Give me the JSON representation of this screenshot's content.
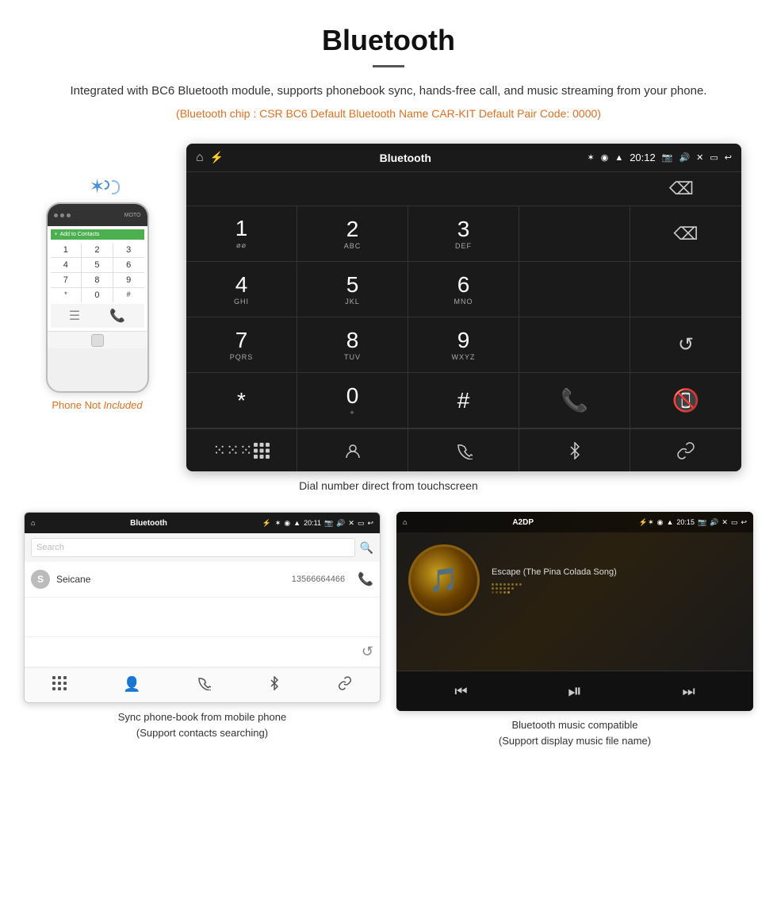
{
  "header": {
    "title": "Bluetooth",
    "description": "Integrated with BC6 Bluetooth module, supports phonebook sync, hands-free call, and music streaming from your phone.",
    "specs": "(Bluetooth chip : CSR BC6    Default Bluetooth Name CAR-KIT    Default Pair Code: 0000)"
  },
  "phone_label": {
    "not": "Phone Not",
    "included": " Included"
  },
  "dial_screen": {
    "status_bar": {
      "title": "Bluetooth",
      "time": "20:12"
    },
    "keys": [
      {
        "num": "1",
        "sub": "∽∽"
      },
      {
        "num": "2",
        "sub": "ABC"
      },
      {
        "num": "3",
        "sub": "DEF"
      },
      {
        "num": "",
        "sub": ""
      },
      {
        "num": "⌫",
        "sub": ""
      },
      {
        "num": "4",
        "sub": "GHI"
      },
      {
        "num": "5",
        "sub": "JKL"
      },
      {
        "num": "6",
        "sub": "MNO"
      },
      {
        "num": "",
        "sub": ""
      },
      {
        "num": "",
        "sub": ""
      },
      {
        "num": "7",
        "sub": "PQRS"
      },
      {
        "num": "8",
        "sub": "TUV"
      },
      {
        "num": "9",
        "sub": "WXYZ"
      },
      {
        "num": "",
        "sub": ""
      },
      {
        "num": "↺",
        "sub": ""
      },
      {
        "num": "*",
        "sub": ""
      },
      {
        "num": "0",
        "sub": "+"
      },
      {
        "num": "#",
        "sub": ""
      },
      {
        "num": "📞",
        "sub": ""
      },
      {
        "num": "📵",
        "sub": ""
      }
    ]
  },
  "dial_caption": "Dial number direct from touchscreen",
  "phonebook": {
    "status_title": "Bluetooth",
    "time": "20:11",
    "search_placeholder": "Search",
    "contact": {
      "initial": "S",
      "name": "Seicane",
      "phone": "13566664466"
    }
  },
  "phonebook_caption_line1": "Sync phone-book from mobile phone",
  "phonebook_caption_line2": "(Support contacts searching)",
  "music": {
    "status_title": "A2DP",
    "time": "20:15",
    "song_title": "Escape (The Pina Colada Song)"
  },
  "music_caption_line1": "Bluetooth music compatible",
  "music_caption_line2": "(Support display music file name)"
}
